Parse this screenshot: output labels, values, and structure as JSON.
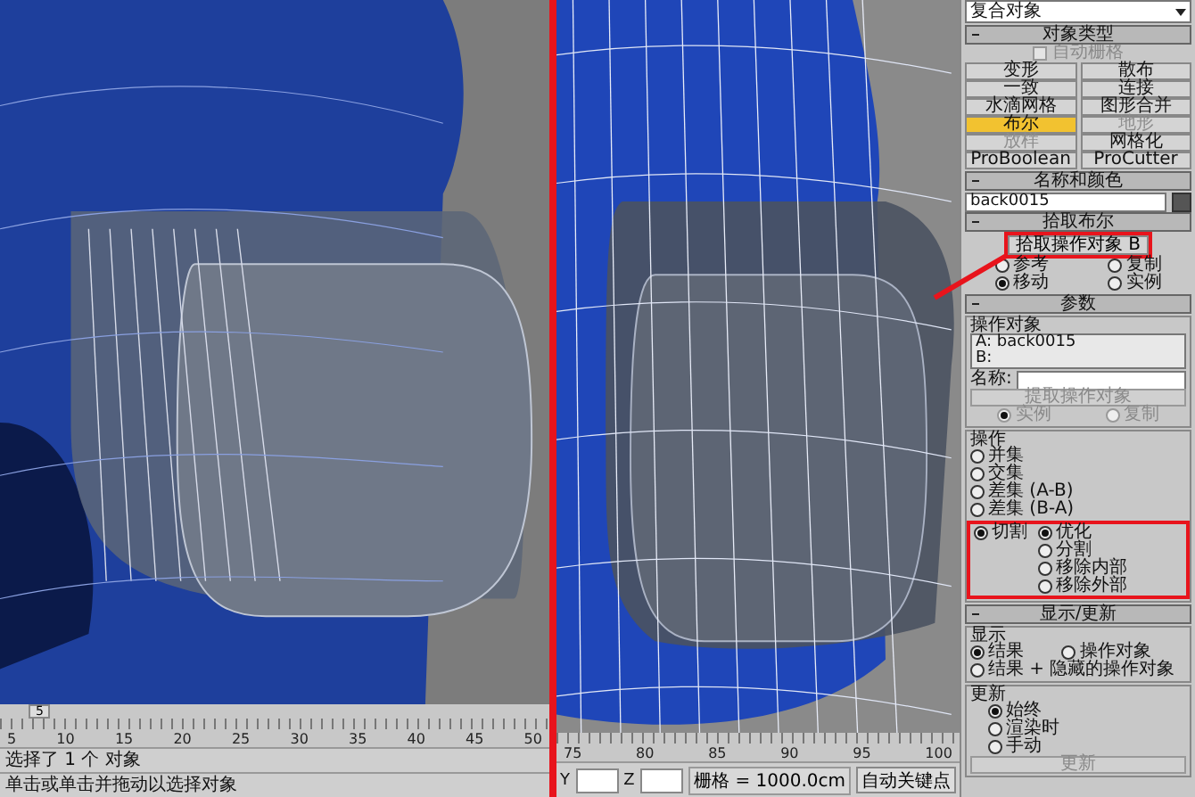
{
  "left_view": {
    "time_slider": "5",
    "ruler": [
      "5",
      "10",
      "15",
      "20",
      "25",
      "30",
      "35",
      "40",
      "45",
      "50"
    ],
    "status": "选择了 1 个 对象",
    "prompt": "单击或单击并拖动以选择对象"
  },
  "right_view": {
    "ruler": [
      "75",
      "80",
      "85",
      "90",
      "95",
      "100"
    ],
    "y_label": "Y",
    "z_label": "Z",
    "grid": "栅格 = 1000.0cm",
    "autokey": "自动关键点"
  },
  "panel": {
    "category": "复合对象",
    "object_type": {
      "title": "对象类型",
      "autogrid": {
        "label": "自动栅格",
        "checked": false,
        "disabled": true
      },
      "buttons": [
        {
          "label": "变形",
          "selected": false,
          "disabled": false
        },
        {
          "label": "散布",
          "selected": false,
          "disabled": false
        },
        {
          "label": "一致",
          "selected": false,
          "disabled": false
        },
        {
          "label": "连接",
          "selected": false,
          "disabled": false
        },
        {
          "label": "水滴网格",
          "selected": false,
          "disabled": false
        },
        {
          "label": "图形合并",
          "selected": false,
          "disabled": false
        },
        {
          "label": "布尔",
          "selected": true,
          "disabled": false
        },
        {
          "label": "地形",
          "selected": false,
          "disabled": true
        },
        {
          "label": "放样",
          "selected": false,
          "disabled": true
        },
        {
          "label": "网格化",
          "selected": false,
          "disabled": false
        },
        {
          "label": "ProBoolean",
          "selected": false,
          "disabled": false
        },
        {
          "label": "ProCutter",
          "selected": false,
          "disabled": false
        }
      ]
    },
    "name_color": {
      "title": "名称和颜色",
      "name": "back0015"
    },
    "pick_boolean": {
      "title": "拾取布尔",
      "button": "拾取操作对象 B",
      "highlighted": true,
      "options": [
        {
          "label": "参考",
          "selected": false
        },
        {
          "label": "复制",
          "selected": false
        },
        {
          "label": "移动",
          "selected": true
        },
        {
          "label": "实例",
          "selected": false
        }
      ]
    },
    "parameters": {
      "title": "参数",
      "operands": {
        "title": "操作对象",
        "items": [
          "A: back0015",
          "B:"
        ]
      },
      "name_label": "名称:",
      "extract_button": {
        "label": "提取操作对象",
        "disabled": true
      },
      "extract_options": [
        {
          "label": "实例",
          "selected": true,
          "disabled": true
        },
        {
          "label": "复制",
          "selected": false,
          "disabled": true
        }
      ],
      "operation": {
        "title": "操作",
        "highlighted": true,
        "options": [
          {
            "label": "并集",
            "selected": false
          },
          {
            "label": "交集",
            "selected": false
          },
          {
            "label": "差集 (A-B)",
            "selected": false
          },
          {
            "label": "差集 (B-A)",
            "selected": false
          }
        ],
        "cut": {
          "label": "切割",
          "selected": true
        },
        "cut_options": [
          {
            "label": "优化",
            "selected": true
          },
          {
            "label": "分割",
            "selected": false
          },
          {
            "label": "移除内部",
            "selected": false
          },
          {
            "label": "移除外部",
            "selected": false
          }
        ]
      }
    },
    "display_update": {
      "title": "显示/更新",
      "display": {
        "title": "显示",
        "options": [
          {
            "label": "结果",
            "selected": true
          },
          {
            "label": "操作对象",
            "selected": false
          },
          {
            "label": "结果 + 隐藏的操作对象",
            "selected": false
          }
        ]
      },
      "update": {
        "title": "更新",
        "options": [
          {
            "label": "始终",
            "selected": true
          },
          {
            "label": "渲染时",
            "selected": false
          },
          {
            "label": "手动",
            "selected": false
          }
        ],
        "button": {
          "label": "更新",
          "disabled": true
        }
      }
    }
  }
}
